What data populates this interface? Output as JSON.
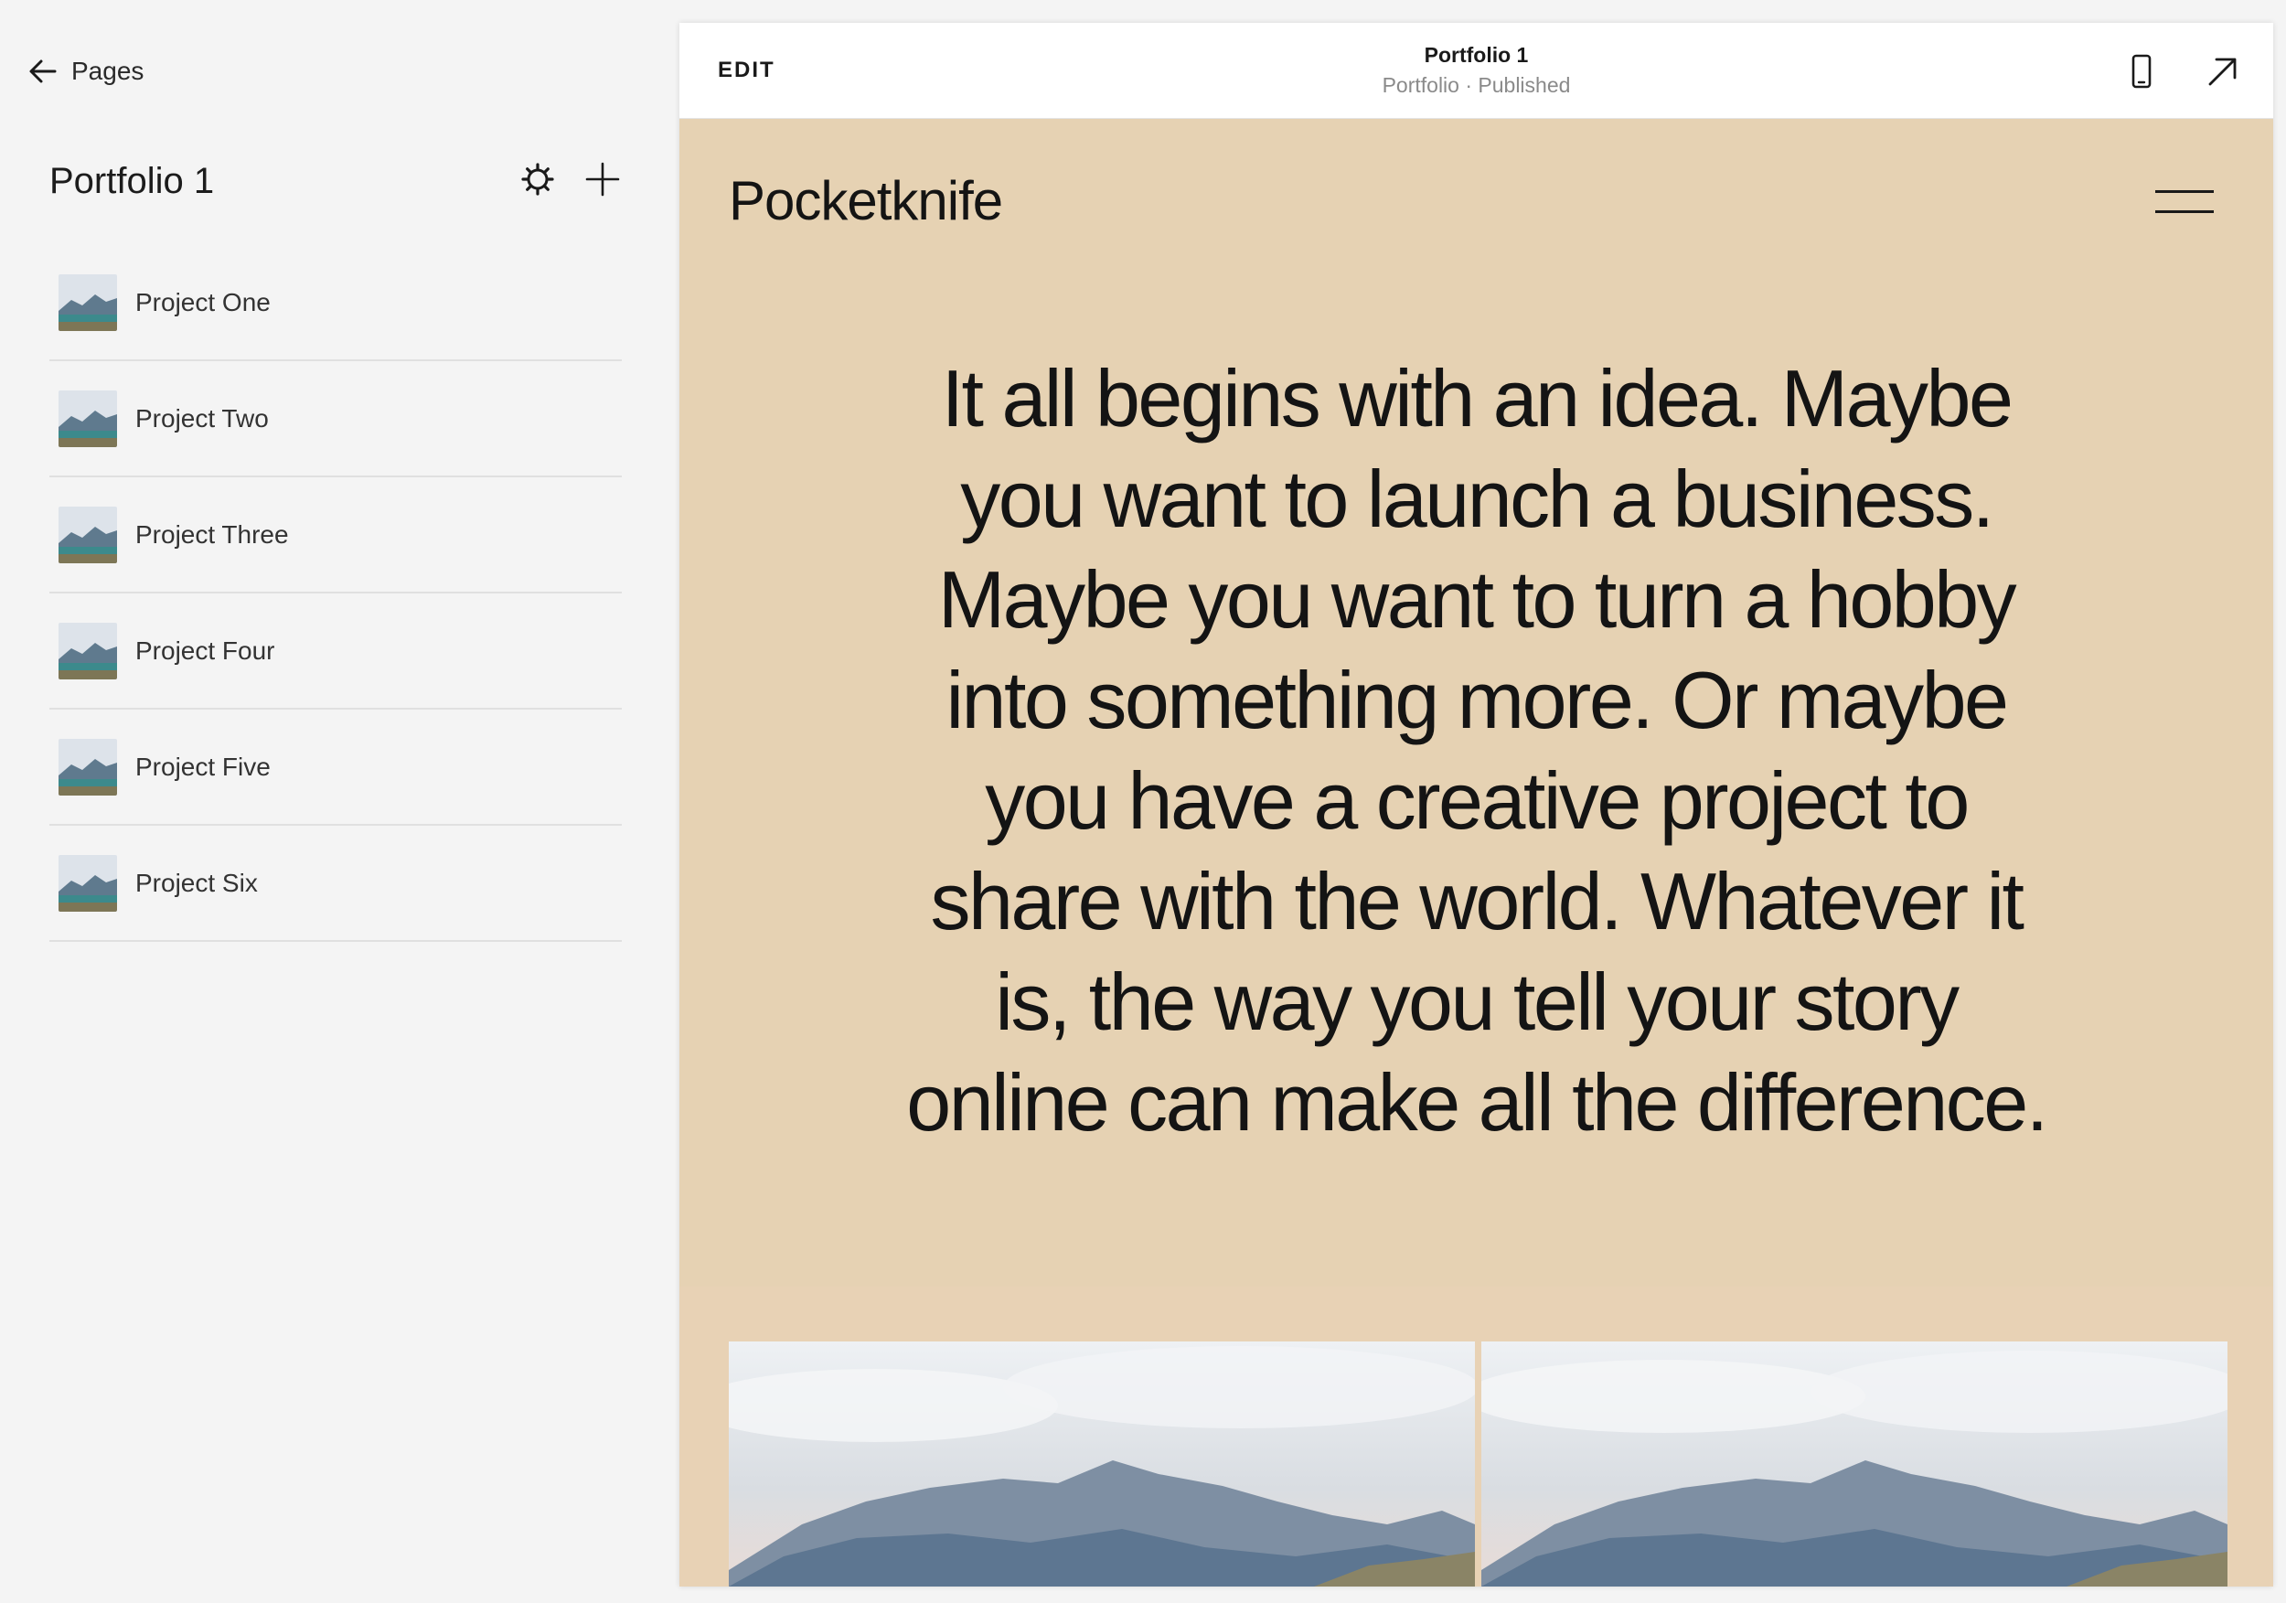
{
  "sidebar": {
    "back_label": "Pages",
    "collection_title": "Portfolio 1",
    "icons": {
      "back": "arrow-left-icon",
      "settings": "gear-icon",
      "add": "plus-icon"
    },
    "items": [
      {
        "label": "Project One"
      },
      {
        "label": "Project Two"
      },
      {
        "label": "Project Three"
      },
      {
        "label": "Project Four"
      },
      {
        "label": "Project Five"
      },
      {
        "label": "Project Six"
      }
    ]
  },
  "preview_bar": {
    "edit_label": "EDIT",
    "page_title": "Portfolio 1",
    "page_status": "Portfolio · Published",
    "icons": {
      "mobile": "mobile-phone-icon",
      "open": "arrow-up-right-icon"
    }
  },
  "site": {
    "logo": "Pocketknife",
    "hero_text": "It all begins with an idea. Maybe you want to launch a business. Maybe you want to turn a hobby into something more. Or maybe you have a creative project to share with the world. Whatever it is, the way you tell your story online can make all the difference.",
    "menu_icon": "hamburger-menu-icon"
  },
  "colors": {
    "sidebar_bg": "#f4f4f4",
    "site_bg": "#e6d2b3",
    "gallery_band": "#e8d2b5",
    "text": "#141414",
    "muted": "#8a8a8a"
  }
}
